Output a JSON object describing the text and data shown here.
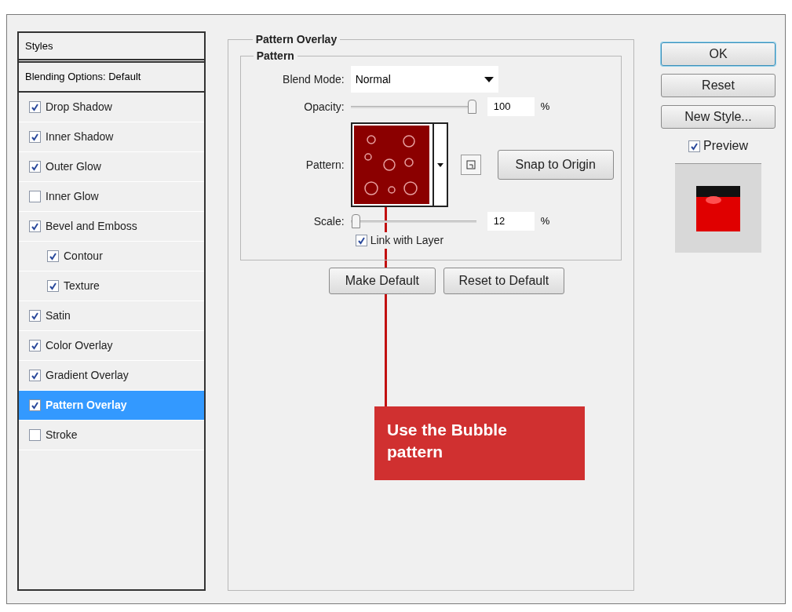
{
  "styles_panel": {
    "header": "Styles",
    "blending_options": "Blending Options: Default",
    "items": [
      {
        "label": "Drop Shadow",
        "checked": true,
        "selected": false
      },
      {
        "label": "Inner Shadow",
        "checked": true,
        "selected": false
      },
      {
        "label": "Outer Glow",
        "checked": true,
        "selected": false
      },
      {
        "label": "Inner Glow",
        "checked": false,
        "selected": false
      },
      {
        "label": "Bevel and Emboss",
        "checked": true,
        "selected": false,
        "children": [
          {
            "label": "Contour",
            "checked": true,
            "selected": false
          },
          {
            "label": "Texture",
            "checked": true,
            "selected": false
          }
        ]
      },
      {
        "label": "Satin",
        "checked": true,
        "selected": false
      },
      {
        "label": "Color Overlay",
        "checked": true,
        "selected": false
      },
      {
        "label": "Gradient Overlay",
        "checked": true,
        "selected": false
      },
      {
        "label": "Pattern Overlay",
        "checked": true,
        "selected": true
      },
      {
        "label": "Stroke",
        "checked": false,
        "selected": false
      }
    ]
  },
  "pattern_overlay": {
    "title": "Pattern Overlay",
    "group_title": "Pattern",
    "blend_mode": {
      "label": "Blend Mode:",
      "value": "Normal"
    },
    "opacity": {
      "label": "Opacity:",
      "level": 1,
      "value": "100",
      "unit": "%"
    },
    "pattern": {
      "label": "Pattern:",
      "snap_button": "Snap to Origin"
    },
    "scale": {
      "label": "Scale:",
      "level": 0.01,
      "value": "12",
      "unit": "%"
    },
    "link_with_layer": {
      "label": "Link with Layer",
      "checked": true
    },
    "buttons": [
      "Make Default",
      "Reset to Default"
    ]
  },
  "side_buttons": [
    "OK",
    "Reset",
    "New Style..."
  ],
  "preview": {
    "label": "Preview",
    "checked": true
  },
  "callout": {
    "text": "Use the Bubble pattern"
  }
}
